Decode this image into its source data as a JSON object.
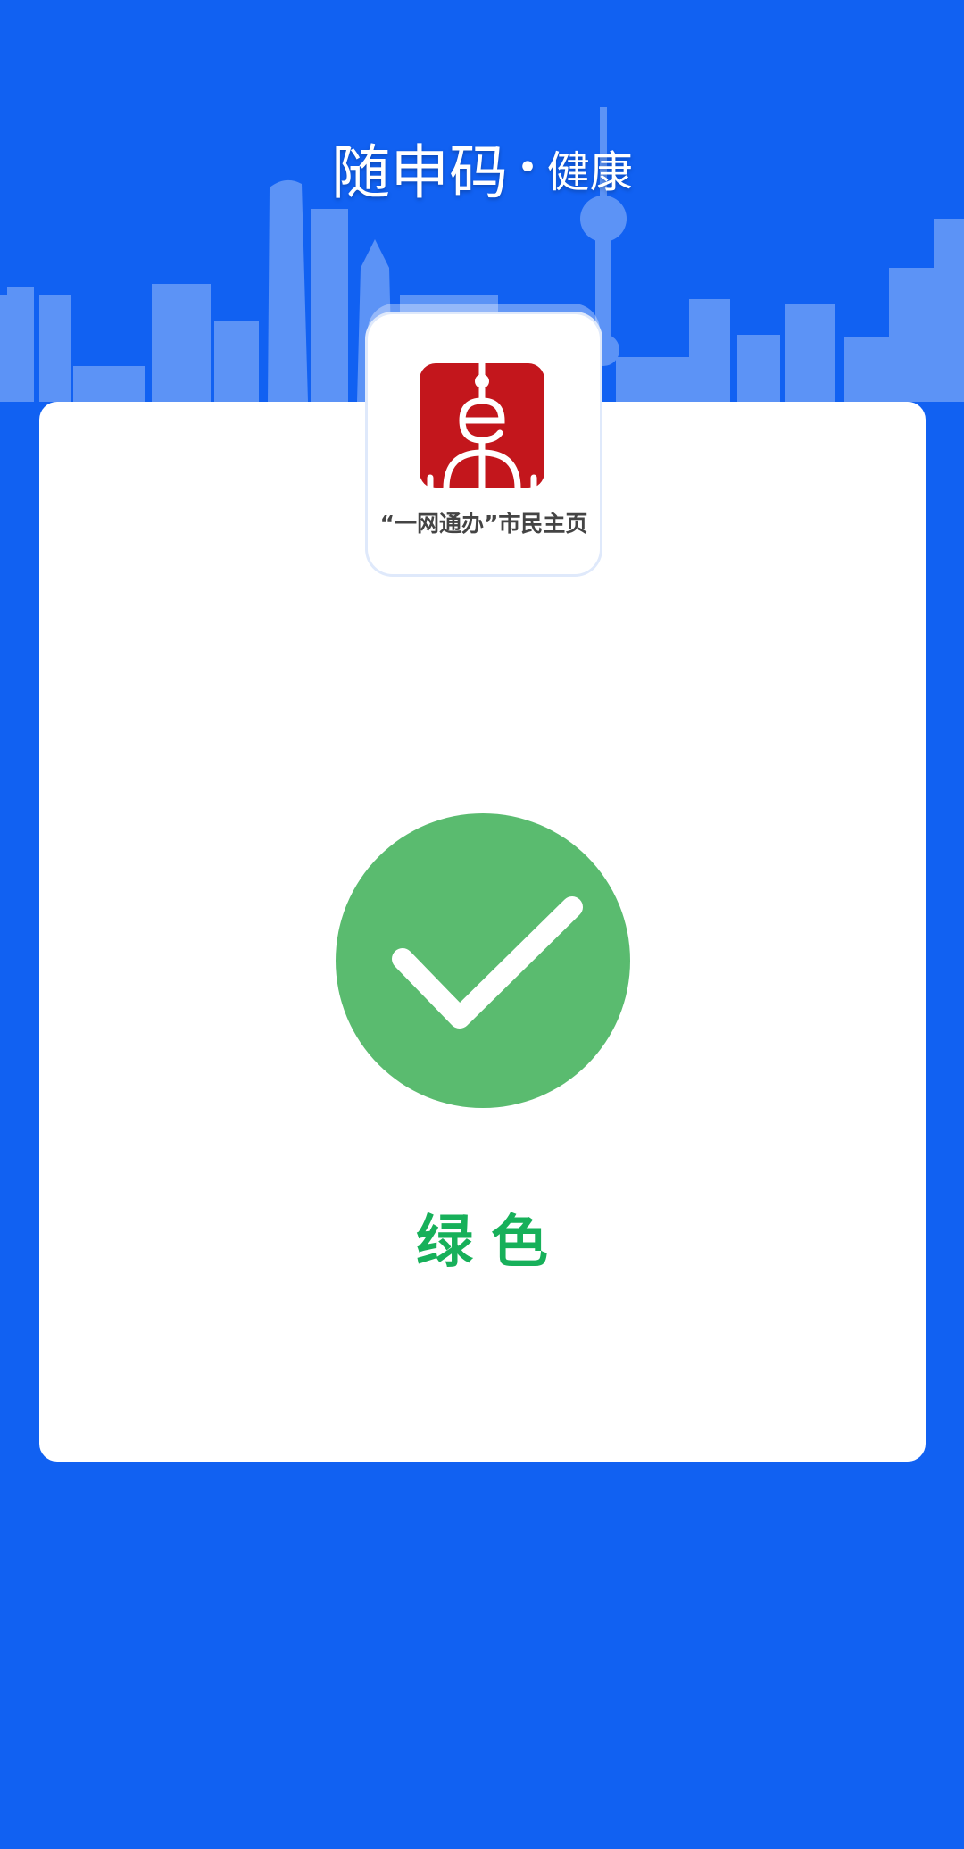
{
  "header": {
    "title_main": "随申码",
    "title_sep": "•",
    "title_sub": "健康"
  },
  "badge": {
    "icon": "shanghai-e-logo-icon",
    "label": "“一网通办”市民主页",
    "icon_color": "#c3161c"
  },
  "status": {
    "icon": "check-circle-icon",
    "label": "绿色",
    "color": "#17b05a",
    "circle_color": "#5abb6f"
  },
  "colors": {
    "background": "#1161f2",
    "card": "#ffffff"
  }
}
